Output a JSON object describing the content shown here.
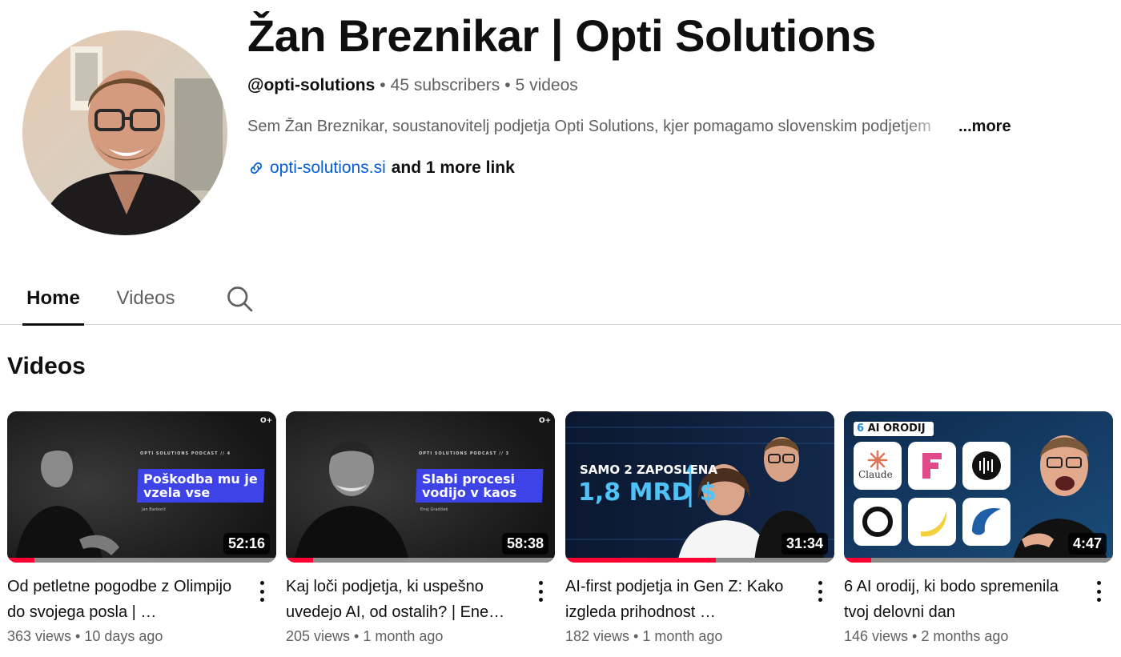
{
  "channel": {
    "name": "Žan Breznikar | Opti Solutions",
    "handle": "@opti-solutions",
    "subscribers": "45 subscribers",
    "video_count": "5 videos",
    "description": "Sem Žan Breznikar, soustanovitelj podjetja Opti Solutions, kjer pomagamo slovenskim podjetjem",
    "more_label": "...more",
    "link_text": "opti-solutions.si",
    "more_links": "and 1 more link"
  },
  "tabs": [
    {
      "label": "Home",
      "active": true
    },
    {
      "label": "Videos",
      "active": false
    }
  ],
  "section_title": "Videos",
  "videos": [
    {
      "title": "Od petletne pogodbe z Olimpijo do svojega posla | …",
      "views": "363 views",
      "age": "10 days ago",
      "duration": "52:16",
      "progress": 0.1,
      "thumb_kicker": "OPTI SOLUTIONS PODCAST // 4",
      "thumb_headline": [
        "Poškodba mu je",
        "vzela vse"
      ],
      "thumb_caption": "Jan Barborič"
    },
    {
      "title": "Kaj loči podjetja, ki uspešno uvedejo AI, od ostalih? | Ene…",
      "views": "205 views",
      "age": "1 month ago",
      "duration": "58:38",
      "progress": 0.1,
      "thumb_kicker": "OPTI SOLUTIONS PODCAST // 3",
      "thumb_headline": [
        "Slabi procesi",
        "vodijo v kaos"
      ],
      "thumb_caption": "Enej Gradišek"
    },
    {
      "title": "AI-first podjetja in Gen Z: Kako izgleda prihodnost …",
      "views": "182 views",
      "age": "1 month ago",
      "duration": "31:34",
      "progress": 0.56,
      "thumb_kicker": "SAMO 2 ZAPOSLENA",
      "thumb_headline": [
        "1,8 MRD $"
      ]
    },
    {
      "title": "6 AI orodij, ki bodo spremenila tvoj delovni dan",
      "views": "146 views",
      "age": "2 months ago",
      "duration": "4:47",
      "progress": 0.1,
      "thumb_badge_num": "6",
      "thumb_badge_text": "AI ORODIJ",
      "thumb_tool_label": "Claude"
    }
  ]
}
